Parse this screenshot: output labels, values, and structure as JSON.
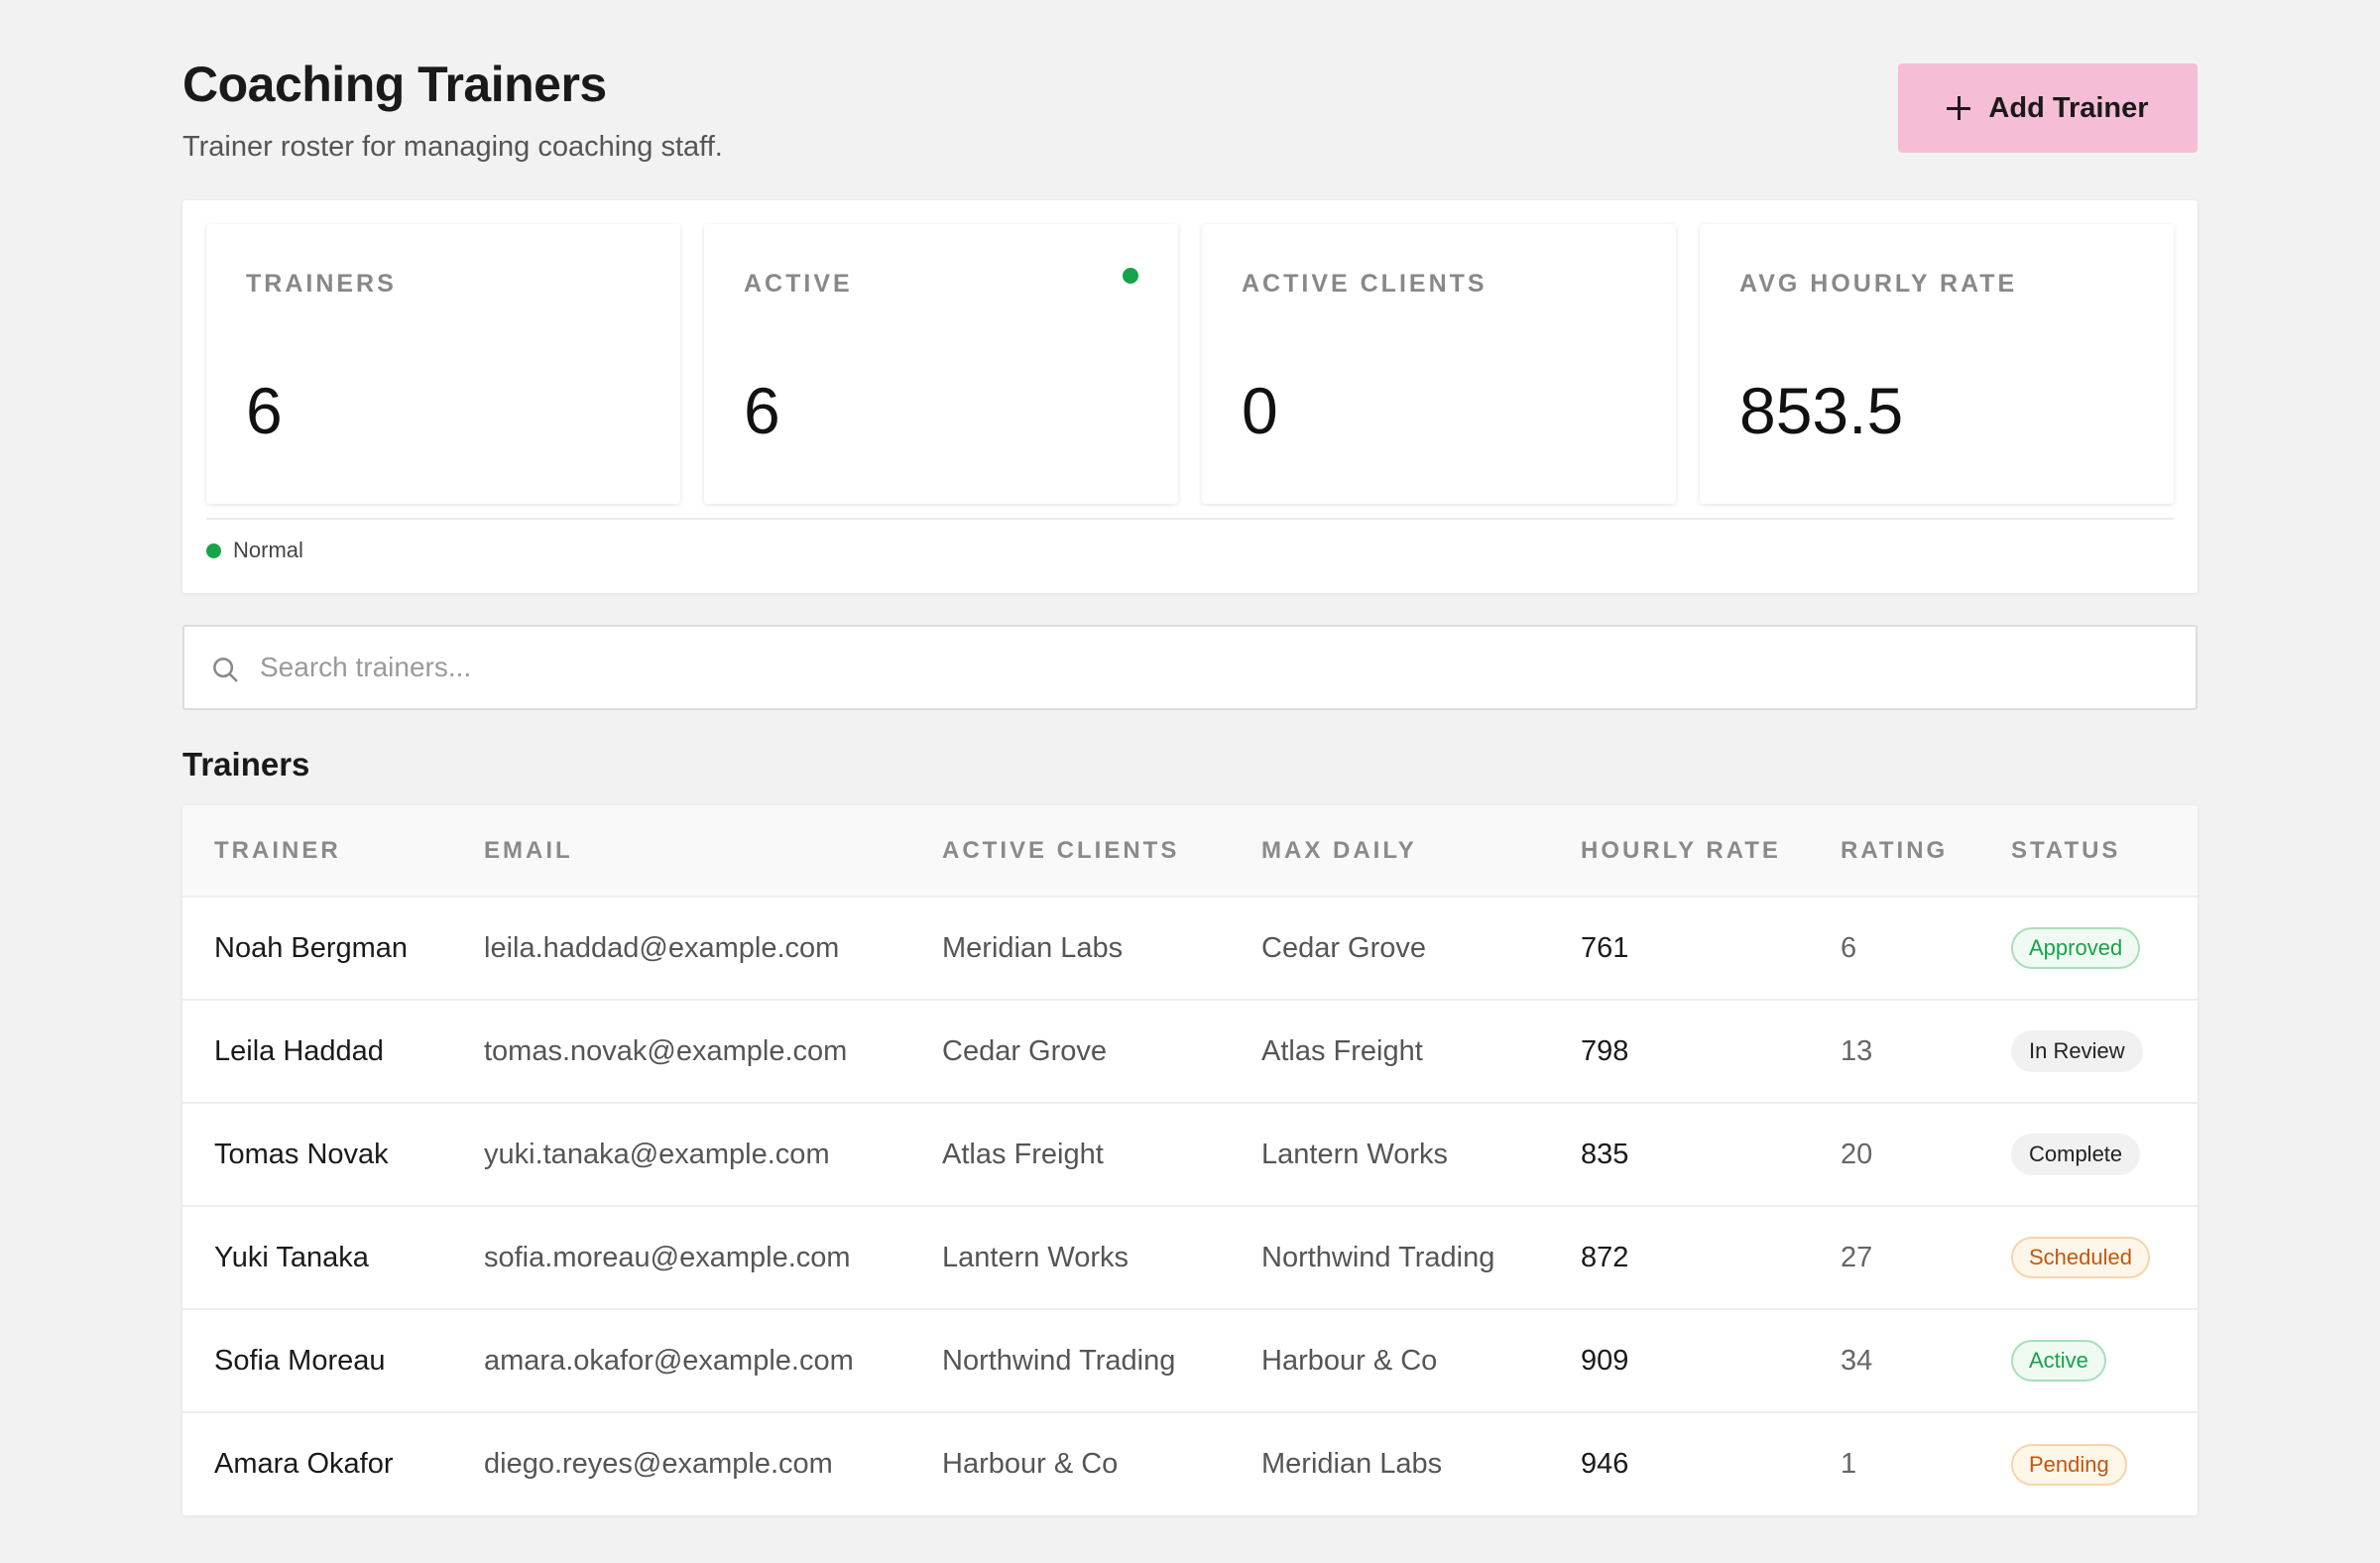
{
  "header": {
    "title": "Coaching Trainers",
    "subtitle": "Trainer roster for managing coaching staff.",
    "add_button_label": "Add Trainer"
  },
  "stats": [
    {
      "label": "TRAINERS",
      "value": "6"
    },
    {
      "label": "ACTIVE",
      "value": "6"
    },
    {
      "label": "ACTIVE CLIENTS",
      "value": "0"
    },
    {
      "label": "AVG HOURLY RATE",
      "value": "853.5"
    }
  ],
  "status_legend": {
    "label": "Normal",
    "color": "#16a34a"
  },
  "search": {
    "placeholder": "Search trainers...",
    "value": ""
  },
  "table": {
    "title": "Trainers",
    "columns": [
      "TRAINER",
      "EMAIL",
      "ACTIVE CLIENTS",
      "MAX DAILY",
      "HOURLY RATE",
      "RATING",
      "STATUS"
    ],
    "rows": [
      {
        "trainer": "Noah Bergman",
        "email": "leila.haddad@example.com",
        "active_clients": "Meridian Labs",
        "max_daily": "Cedar Grove",
        "hourly_rate": "761",
        "rating": "6",
        "status": "Approved",
        "status_variant": "approved"
      },
      {
        "trainer": "Leila Haddad",
        "email": "tomas.novak@example.com",
        "active_clients": "Cedar Grove",
        "max_daily": "Atlas Freight",
        "hourly_rate": "798",
        "rating": "13",
        "status": "In Review",
        "status_variant": "review"
      },
      {
        "trainer": "Tomas Novak",
        "email": "yuki.tanaka@example.com",
        "active_clients": "Atlas Freight",
        "max_daily": "Lantern Works",
        "hourly_rate": "835",
        "rating": "20",
        "status": "Complete",
        "status_variant": "complete"
      },
      {
        "trainer": "Yuki Tanaka",
        "email": "sofia.moreau@example.com",
        "active_clients": "Lantern Works",
        "max_daily": "Northwind Trading",
        "hourly_rate": "872",
        "rating": "27",
        "status": "Scheduled",
        "status_variant": "scheduled"
      },
      {
        "trainer": "Sofia Moreau",
        "email": "amara.okafor@example.com",
        "active_clients": "Northwind Trading",
        "max_daily": "Harbour & Co",
        "hourly_rate": "909",
        "rating": "34",
        "status": "Active",
        "status_variant": "active"
      },
      {
        "trainer": "Amara Okafor",
        "email": "diego.reyes@example.com",
        "active_clients": "Harbour & Co",
        "max_daily": "Meridian Labs",
        "hourly_rate": "946",
        "rating": "1",
        "status": "Pending",
        "status_variant": "pending"
      }
    ]
  },
  "colors": {
    "accent": "#f6bed6",
    "status_ok": "#16a34a"
  }
}
